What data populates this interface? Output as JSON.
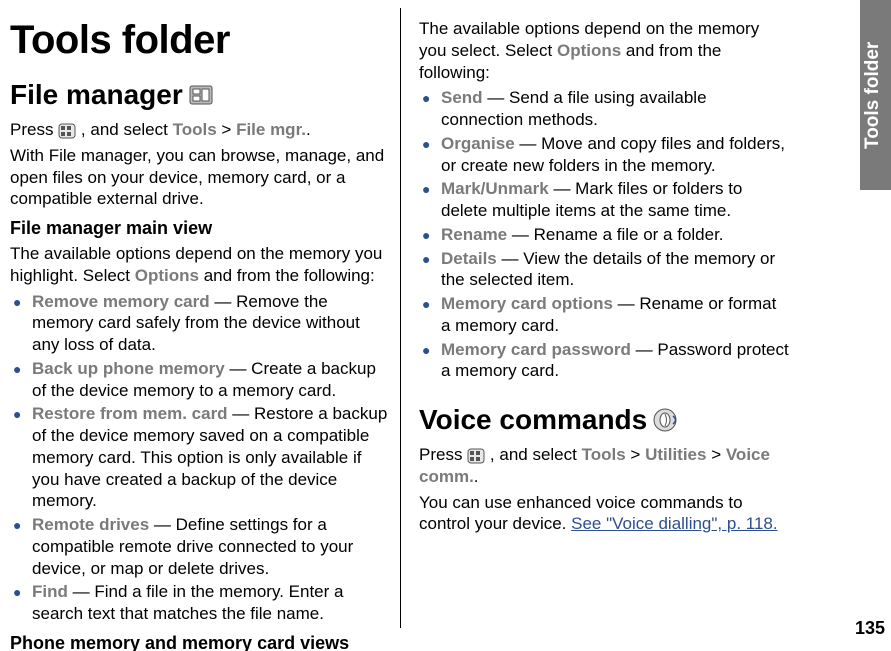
{
  "sideTab": "Tools folder",
  "pageNumber": "135",
  "col1": {
    "title": "Tools folder",
    "h2_filemgr": "File manager",
    "press1a": "Press ",
    "press1b": ", and select ",
    "tools": "Tools",
    "gt": " > ",
    "filemgr_label": "File mgr.",
    "period": ".",
    "p_intro": "With File manager, you can browse, manage, and open files on your device, memory card, or a compatible external drive.",
    "h3_main": "File manager main view",
    "p_main": "The available options depend on the memory you highlight. Select ",
    "options": "Options",
    "p_main2": " and from the following:",
    "items": [
      {
        "label": "Remove memory card",
        "text": " — Remove the memory card safely from the device without any loss of data."
      },
      {
        "label": "Back up phone memory",
        "text": " — Create a backup of the device memory to a memory card."
      },
      {
        "label": "Restore from mem. card",
        "text": " — Restore a backup of the device memory saved on a compatible memory card. This option is only available if you have created a backup of the device memory."
      },
      {
        "label": "Remote drives",
        "text": " — Define settings for a compatible remote drive connected to your device, or map or delete drives."
      },
      {
        "label": "Find",
        "text": " — Find a file in the memory. Enter a search text that matches the file name."
      }
    ],
    "h3_phone": "Phone memory and memory card views"
  },
  "col2": {
    "p_top1": "The available options depend on the memory you select. Select ",
    "p_top2": " and from the following:",
    "items": [
      {
        "label": "Send",
        "text": " — Send a file using available connection methods."
      },
      {
        "label": "Organise",
        "text": " — Move and copy files and folders, or create new folders in the memory."
      },
      {
        "label": "Mark/Unmark",
        "text": " — Mark files or folders to delete multiple items at the same time."
      },
      {
        "label": "Rename",
        "text": " — Rename a file or a folder."
      },
      {
        "label": "Details",
        "text": " — View the details of the memory or the selected item."
      },
      {
        "label": "Memory card options",
        "text": " — Rename or format a memory card."
      },
      {
        "label": "Memory card password",
        "text": " — Password protect a memory card."
      }
    ],
    "h2_voice": "Voice commands",
    "press2a": "Press ",
    "press2b": ", and select ",
    "utilities": "Utilities",
    "voicecomm": "Voice comm.",
    "p_voice": "You can use enhanced voice commands to control your device. ",
    "link": "See \"Voice dialling\", p. 118."
  }
}
